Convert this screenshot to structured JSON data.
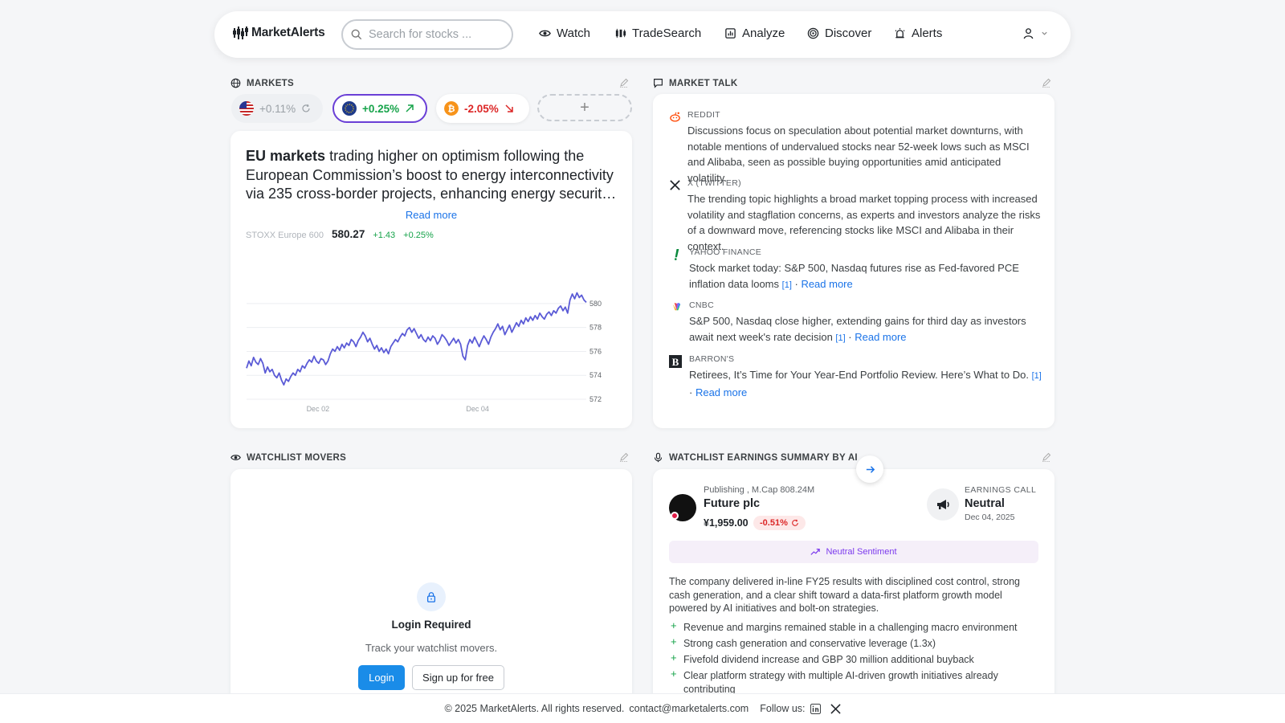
{
  "app": {
    "brand": "MarketAlerts"
  },
  "header": {
    "search_placeholder": "Search for stocks ...",
    "nav": [
      "Watch",
      "TradeSearch",
      "Analyze",
      "Discover",
      "Alerts"
    ]
  },
  "markets": {
    "title": "MARKETS",
    "pills": [
      {
        "region": "US",
        "change": "+0.11%"
      },
      {
        "region": "EU",
        "change": "+0.25%"
      },
      {
        "region": "Crypto",
        "change": "-2.05%"
      }
    ],
    "add_label": "+",
    "headline_bold": "EU markets",
    "headline_rest": " trading higher on optimism following the European Commission’s boost to energy interconnectivity via 235 cross-border projects, enhancing energy security and resilience across the region.",
    "read_more": "Read more",
    "index": {
      "name": "STOXX Europe 600",
      "value": "580.27",
      "change": "+1.43",
      "change_pct": "+0.25%"
    }
  },
  "chart_data": {
    "type": "line",
    "series": [
      {
        "values": [
          574.6,
          575.2,
          574.8,
          575.5,
          575.1,
          574.9,
          575.4,
          575.0,
          574.2,
          574.7,
          574.3,
          574.5,
          574.0,
          573.8,
          574.2,
          573.6,
          573.2,
          573.7,
          573.5,
          573.9,
          574.2,
          574.0,
          574.5,
          574.3,
          574.8,
          574.6,
          575.0,
          575.3,
          575.1,
          575.6,
          575.2,
          575.0,
          575.4,
          575.3,
          574.9,
          575.2,
          575.8,
          576.2,
          576.0,
          576.4,
          576.1,
          576.6,
          576.3,
          576.7,
          576.5,
          577.0,
          576.8,
          576.4,
          576.9,
          577.2,
          577.6,
          577.3,
          576.8,
          577.1,
          576.6,
          576.2,
          576.5,
          576.0,
          576.3,
          575.9,
          576.2,
          575.8,
          576.4,
          576.7,
          577.0,
          576.8,
          577.2,
          577.5,
          577.3,
          577.8,
          578.0,
          577.6,
          577.9,
          577.5,
          577.1,
          577.4,
          577.0,
          576.8,
          577.2,
          576.9,
          577.3,
          577.1,
          576.6,
          576.9,
          577.4,
          577.2,
          576.9,
          576.5,
          576.8,
          577.1,
          576.7,
          577.0,
          576.6,
          575.6,
          575.3,
          576.5,
          577.0,
          576.7,
          577.2,
          576.8,
          576.4,
          576.9,
          577.3,
          577.0,
          576.6,
          577.2,
          577.6,
          577.9,
          578.3,
          577.8,
          578.1,
          577.4,
          577.8,
          578.2,
          577.6,
          578.0,
          578.4,
          578.1,
          578.6,
          578.3,
          578.8,
          578.5,
          578.9,
          578.6,
          579.0,
          578.7,
          579.2,
          578.9,
          578.7,
          579.1,
          579.3,
          579.0,
          579.4,
          579.2,
          579.6,
          579.8,
          579.4,
          579.7,
          579.2,
          580.3,
          580.8,
          580.4,
          580.9,
          580.5,
          580.7,
          580.3,
          580.1
        ]
      }
    ],
    "x_ticks": [
      "Dec 02",
      "Dec 04"
    ],
    "y_ticks": [
      580,
      578,
      576,
      574,
      572
    ],
    "ylim": [
      571.8,
      581.2
    ],
    "color": "#5b5bd6",
    "grid": true
  },
  "market_talk": {
    "title": "MARKET TALK",
    "items": [
      {
        "source": "REDDIT",
        "text": "Discussions focus on speculation about potential market downturns, with notable mentions of undervalued stocks near 52-week lows such as MSCI and Alibaba, seen as possible buying opportunities amid anticipated volatility.",
        "cite": "",
        "read_more": ""
      },
      {
        "source": "X (TWITTER)",
        "text": "The trending topic highlights a broad market topping process with increased volatility and stagflation concerns, as experts and investors analyze the risks of a downward move, referencing stocks like MSCI and Alibaba in their context.",
        "cite": "",
        "read_more": ""
      },
      {
        "source": "YAHOO FINANCE",
        "text": "Stock market today: S&P 500, Nasdaq futures rise as Fed-favored PCE inflation data looms",
        "cite": "[1]",
        "read_more": "Read more"
      },
      {
        "source": "CNBC",
        "text": "S&P 500, Nasdaq close higher, extending gains for third day as investors await next week's rate decision",
        "cite": "[1]",
        "read_more": "Read more"
      },
      {
        "source": "BARRON'S",
        "text": "Retirees, It’s Time for Your Year-End Portfolio Review. Here’s What to Do.",
        "cite": "[1]",
        "read_more": "Read more"
      }
    ]
  },
  "watchlist_movers": {
    "title": "WATCHLIST MOVERS",
    "login_title": "Login Required",
    "login_sub": "Track your watchlist movers.",
    "login_btn": "Login",
    "signup_btn": "Sign up for free"
  },
  "earnings": {
    "title": "WATCHLIST EARNINGS SUMMARY BY AI",
    "company_meta": "Publishing , M.Cap 808.24M",
    "company_name": "Future plc",
    "price": "¥1,959.00",
    "change": "-0.51%",
    "call_label": "EARNINGS CALL",
    "call_sentiment": "Neutral",
    "call_date": "Dec 04, 2025",
    "sentiment_label": "Neutral Sentiment",
    "summary": "The company delivered in-line FY25 results with disciplined cost control, strong cash generation, and a clear shift toward a data-first platform growth model powered by AI initiatives and bolt-on strategies.",
    "bullets": [
      "Revenue and margins remained stable in a challenging macro environment",
      "Strong cash generation and conservative leverage (1.3x)",
      "Fivefold dividend increase and GBP 30 million additional buyback",
      "Clear platform strategy with multiple AI-driven growth initiatives already contributing"
    ]
  },
  "footer": {
    "copyright": "© 2025 MarketAlerts. All rights reserved.",
    "contact": "contact@marketalerts.com",
    "follow": "Follow us:"
  },
  "colors": {
    "accent": "#1a73e8",
    "positive": "#16a34a",
    "negative": "#dc2626",
    "eu_border": "#6a3fd6"
  }
}
